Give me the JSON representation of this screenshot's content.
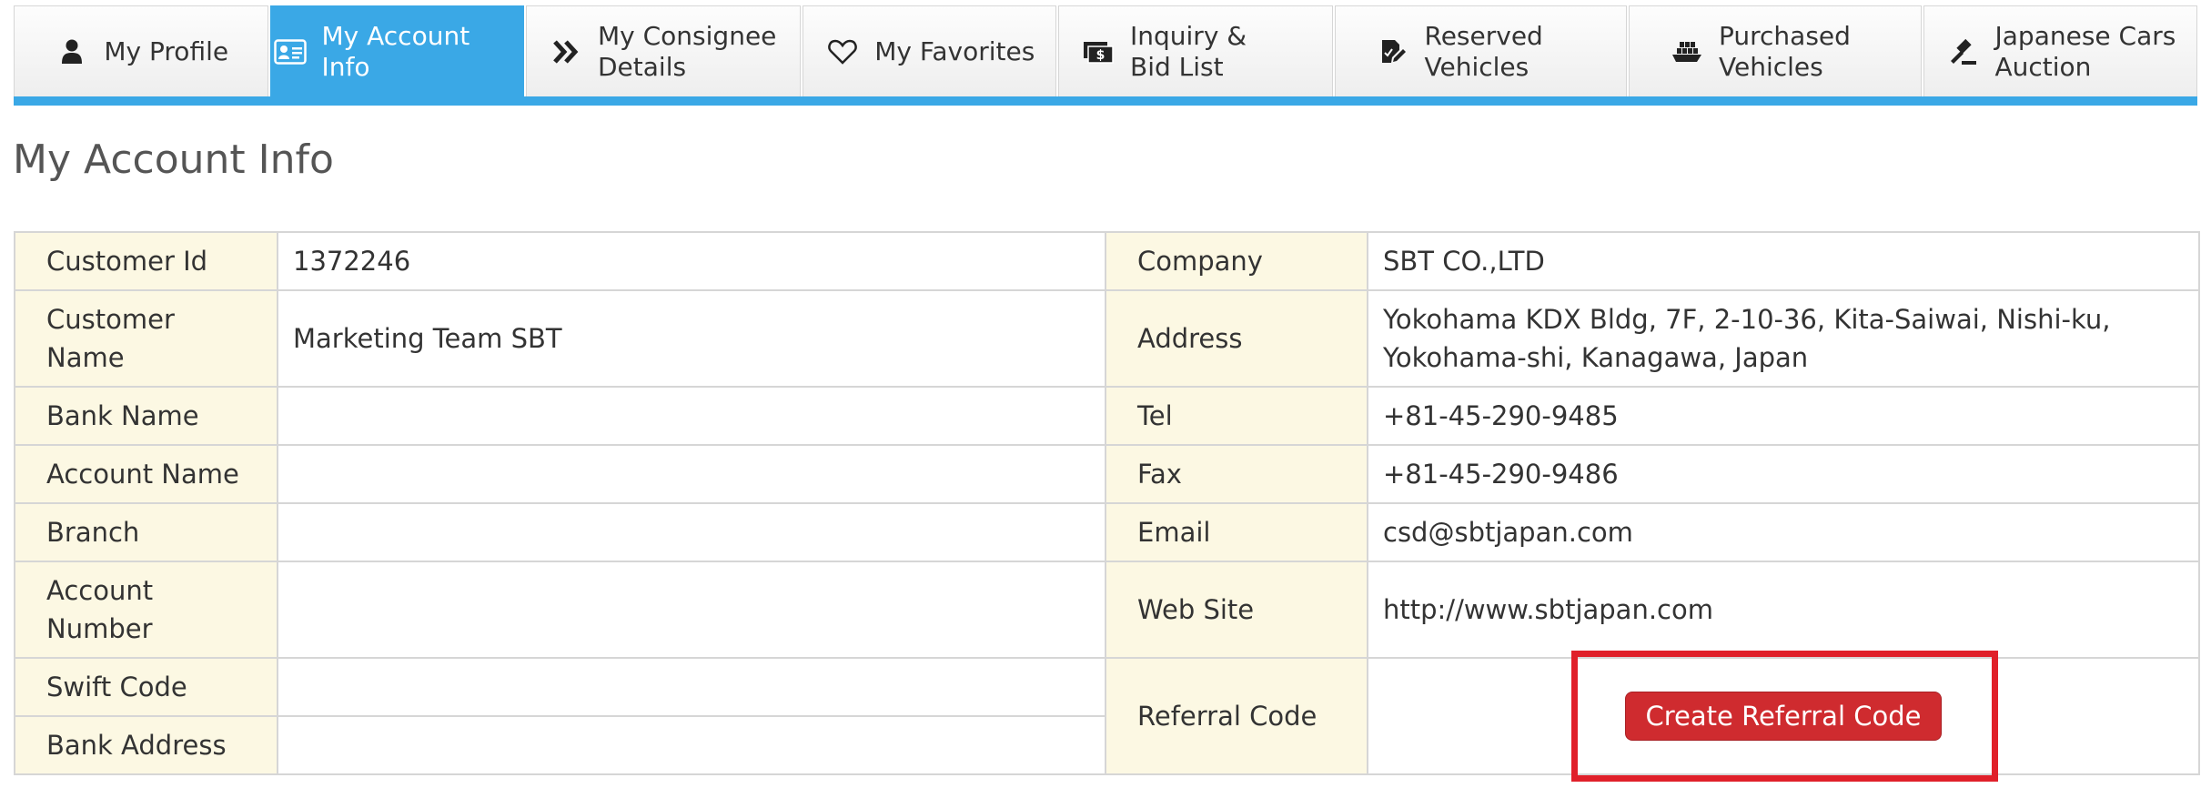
{
  "tabs": [
    {
      "label": "My Profile",
      "icon": "user-icon",
      "active": false
    },
    {
      "label": "My Account Info",
      "icon": "id-card-icon",
      "active": true
    },
    {
      "label": "My Consignee\nDetails",
      "icon": "double-chevron-right-icon",
      "active": false
    },
    {
      "label": "My Favorites",
      "icon": "heart-icon",
      "active": false
    },
    {
      "label": "Inquiry &\nBid List",
      "icon": "money-icon",
      "active": false
    },
    {
      "label": "Reserved\nVehicles",
      "icon": "edit-document-icon",
      "active": false
    },
    {
      "label": "Purchased\nVehicles",
      "icon": "ship-icon",
      "active": false
    },
    {
      "label": "Japanese Cars\nAuction",
      "icon": "gavel-icon",
      "active": false
    }
  ],
  "page_title": "My Account Info",
  "rows": {
    "customer_id": {
      "label": "Customer Id",
      "value": "1372246"
    },
    "company": {
      "label": "Company",
      "value": "SBT CO.,LTD"
    },
    "customer_name": {
      "label": "Customer\nName",
      "value": "Marketing Team SBT"
    },
    "address": {
      "label": "Address",
      "value": "Yokohama KDX Bldg, 7F, 2-10-36, Kita-Saiwai, Nishi-ku,\nYokohama-shi, Kanagawa, Japan"
    },
    "bank_name": {
      "label": "Bank Name",
      "value": ""
    },
    "tel": {
      "label": "Tel",
      "value": "+81-45-290-9485"
    },
    "account_name": {
      "label": "Account Name",
      "value": ""
    },
    "fax": {
      "label": "Fax",
      "value": "+81-45-290-9486"
    },
    "branch": {
      "label": "Branch",
      "value": ""
    },
    "email": {
      "label": "Email",
      "value": "csd@sbtjapan.com"
    },
    "account_number": {
      "label": "Account\nNumber",
      "value": ""
    },
    "website": {
      "label": "Web Site",
      "value": "http://www.sbtjapan.com"
    },
    "swift_code": {
      "label": "Swift Code",
      "value": ""
    },
    "referral_code": {
      "label": "Referral Code",
      "button": "Create Referral Code"
    },
    "bank_address": {
      "label": "Bank Address",
      "value": ""
    }
  },
  "colors": {
    "accent": "#3aa8e6",
    "label_bg": "#fcf8e3",
    "button_red": "#cf2b2f",
    "highlight_red": "#e0202a"
  }
}
